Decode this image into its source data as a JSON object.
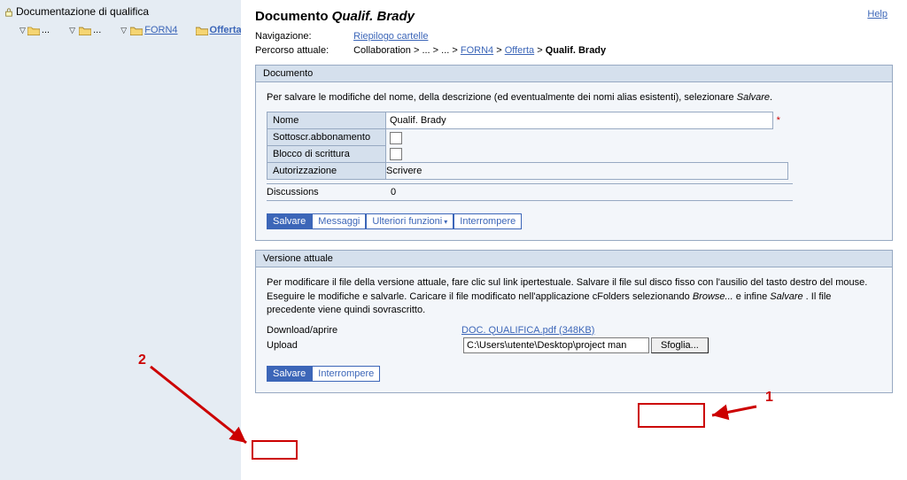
{
  "help": "Help",
  "sidebar": {
    "title": "Documentazione di qualifica",
    "root": "...",
    "node1": "...",
    "node2": "FORN4",
    "node3": "Offerta"
  },
  "main": {
    "title_prefix": "Documento ",
    "title_name": "Qualif. Brady",
    "nav_label": "Navigazione:",
    "nav_link": "Riepilogo cartelle",
    "path_label": "Percorso attuale:",
    "crumb0": "Collaboration",
    "crumb1": "...",
    "crumb2": "...",
    "crumb3": "FORN4",
    "crumb4": "Offerta",
    "crumb5": "Qualif. Brady",
    "sep": " > "
  },
  "docpanel": {
    "header": "Documento",
    "intro1": "Per salvare le modifiche del nome, della descrizione (ed eventualmente dei nomi alias esistenti), selezionare ",
    "intro2": "Salvare",
    "intro3": ".",
    "label_name": "Nome",
    "value_name": "Qualif. Brady",
    "label_sub": "Sottoscr.abbonamento",
    "label_write": "Blocco di scrittura",
    "label_auth": "Autorizzazione",
    "value_auth": "Scrivere",
    "label_disc": "Discussions",
    "value_disc": "0",
    "btn_save": "Salvare",
    "btn_msg": "Messaggi",
    "btn_more": "Ulteriori funzioni",
    "btn_cancel": "Interrompere"
  },
  "verpanel": {
    "header": "Versione attuale",
    "body": "Per modificare il file della versione attuale, fare clic sul link ipertestuale. Salvare il file sul disco fisso con l'ausilio del tasto destro del mouse. Eseguire le modifiche e salvarle. Caricare il file modificato nell'applicazione cFolders selezionando ",
    "body_i1": "Browse...",
    "body_mid": " e infine ",
    "body_i2": "Salvare",
    "body_end": ". Il file precedente viene quindi sovrascritto.",
    "dl_label": "Download/aprire",
    "dl_link": "DOC. QUALIFICA.pdf (348KB)",
    "up_label": "Upload",
    "up_value": "C:\\Users\\utente\\Desktop\\project man",
    "browse": "Sfoglia...",
    "btn_save": "Salvare",
    "btn_cancel": "Interrompere"
  },
  "annotations": {
    "one": "1",
    "two": "2"
  }
}
